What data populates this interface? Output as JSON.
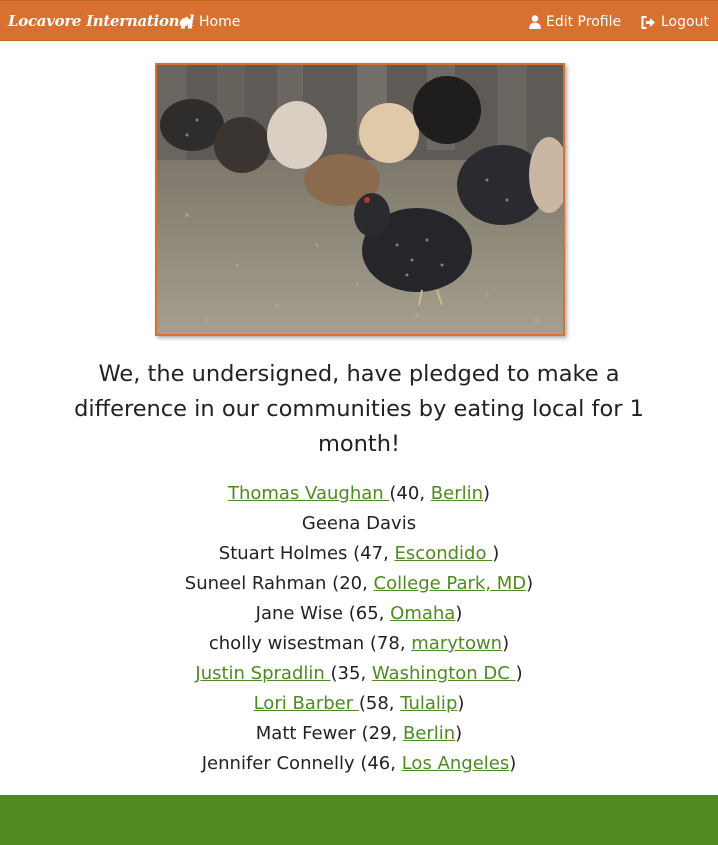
{
  "navbar": {
    "brand": "Locavore International",
    "home_label": "Home",
    "edit_profile_label": "Edit Profile",
    "logout_label": "Logout",
    "color": "#d8702f"
  },
  "hero": {
    "alt": "Chickens foraging in a coop"
  },
  "pledge_text": "We, the undersigned, have pledged to make a difference in our communities by eating local for 1 month!",
  "signers": [
    {
      "name": "Thomas Vaughan ",
      "name_link": true,
      "age": "40",
      "location": "Berlin"
    },
    {
      "name": "Geena Davis",
      "name_link": false,
      "age": "",
      "location": ""
    },
    {
      "name": "Stuart Holmes",
      "name_link": false,
      "age": "47",
      "location": "Escondido "
    },
    {
      "name": "Suneel Rahman",
      "name_link": false,
      "age": "20",
      "location": "College Park, MD"
    },
    {
      "name": "Jane Wise",
      "name_link": false,
      "age": "65",
      "location": "Omaha"
    },
    {
      "name": "cholly wisestman",
      "name_link": false,
      "age": "78",
      "location": "marytown"
    },
    {
      "name": "Justin Spradlin ",
      "name_link": true,
      "age": "35",
      "location": "Washington DC "
    },
    {
      "name": "Lori Barber ",
      "name_link": true,
      "age": "58",
      "location": "Tulalip"
    },
    {
      "name": "Matt Fewer",
      "name_link": false,
      "age": "29",
      "location": "Berlin"
    },
    {
      "name": "Jennifer Connelly",
      "name_link": false,
      "age": "46",
      "location": "Los Angeles"
    }
  ],
  "colors": {
    "accent_orange": "#d8702f",
    "link_green": "#4e8a22",
    "footer_green": "#4e8a1f"
  }
}
